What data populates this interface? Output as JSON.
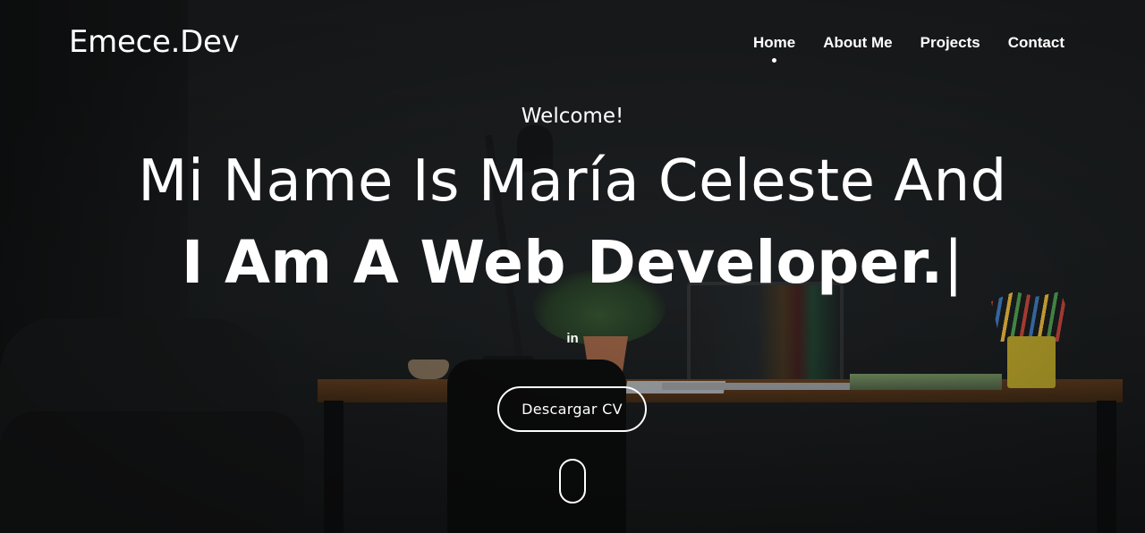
{
  "brand": {
    "logo_text": "Emece.Dev"
  },
  "nav": {
    "items": [
      {
        "label": "Home",
        "active": true
      },
      {
        "label": "About Me",
        "active": false
      },
      {
        "label": "Projects",
        "active": false
      },
      {
        "label": "Contact",
        "active": false
      }
    ]
  },
  "hero": {
    "welcome": "Welcome!",
    "headline_line1": "Mi Name Is María Celeste And",
    "headline_line2": "I Am A Web Developer.",
    "typing_cursor": "|",
    "social": {
      "linkedin_glyph": "in",
      "icon": "linkedin-icon"
    },
    "cta_label": "Descargar CV",
    "scroll_indicator_icon": "mouse-scroll-icon"
  },
  "colors": {
    "background": "#1b1e20",
    "text": "#ffffff",
    "desk_wood": "#5a3a1e"
  }
}
